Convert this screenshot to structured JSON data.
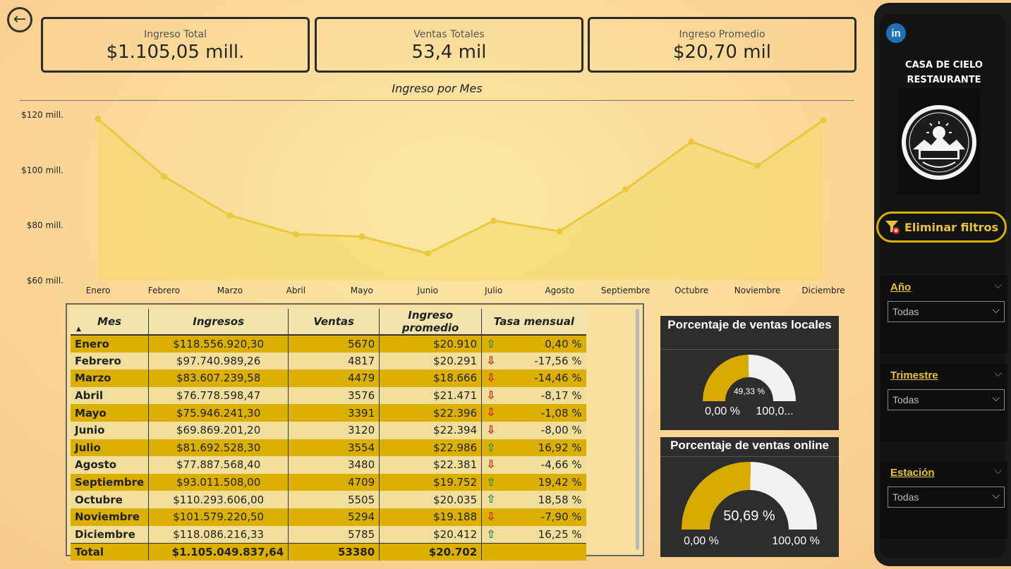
{
  "kpis": [
    {
      "label": "Ingreso Total",
      "value": "$1.105,05 mill."
    },
    {
      "label": "Ventas Totales",
      "value": "53,4 mil"
    },
    {
      "label": "Ingreso Promedio",
      "value": "$20,70 mil"
    }
  ],
  "chart_data": {
    "type": "area",
    "title": "Ingreso por Mes",
    "xlabel": "",
    "ylabel": "",
    "categories": [
      "Enero",
      "Febrero",
      "Marzo",
      "Abril",
      "Mayo",
      "Junio",
      "Julio",
      "Agosto",
      "Septiembre",
      "Octubre",
      "Noviembre",
      "Diciembre"
    ],
    "values": [
      118.56,
      97.74,
      83.61,
      76.78,
      75.95,
      69.87,
      81.69,
      77.89,
      93.01,
      110.29,
      101.58,
      118.09
    ],
    "yticks": [
      60,
      80,
      100,
      120
    ],
    "ytick_labels": [
      "$60 mill.",
      "$80 mill.",
      "$100 mill.",
      "$120 mill."
    ],
    "ylim": [
      60,
      120
    ],
    "unit": "mill.",
    "color": "#e9c93e",
    "fill_color": "#f3d868",
    "grid": false
  },
  "table": {
    "headers": [
      "Mes",
      "Ingresos",
      "Ventas",
      "Ingreso promedio",
      "Tasa mensual"
    ],
    "rows": [
      {
        "mes": "Enero",
        "ingresos": "$118.556.920,30",
        "ventas": "5670",
        "promedio": "$20.910",
        "tasa": "0,40 %",
        "trend": "up"
      },
      {
        "mes": "Febrero",
        "ingresos": "$97.740.989,26",
        "ventas": "4817",
        "promedio": "$20.291",
        "tasa": "-17,56 %",
        "trend": "down"
      },
      {
        "mes": "Marzo",
        "ingresos": "$83.607.239,58",
        "ventas": "4479",
        "promedio": "$18.666",
        "tasa": "-14,46 %",
        "trend": "down"
      },
      {
        "mes": "Abril",
        "ingresos": "$76.778.598,47",
        "ventas": "3576",
        "promedio": "$21.471",
        "tasa": "-8,17 %",
        "trend": "down"
      },
      {
        "mes": "Mayo",
        "ingresos": "$75.946.241,30",
        "ventas": "3391",
        "promedio": "$22.396",
        "tasa": "-1,08 %",
        "trend": "down"
      },
      {
        "mes": "Junio",
        "ingresos": "$69.869.201,20",
        "ventas": "3120",
        "promedio": "$22.394",
        "tasa": "-8,00 %",
        "trend": "down"
      },
      {
        "mes": "Julio",
        "ingresos": "$81.692.528,30",
        "ventas": "3554",
        "promedio": "$22.986",
        "tasa": "16,92 %",
        "trend": "up"
      },
      {
        "mes": "Agosto",
        "ingresos": "$77.887.568,40",
        "ventas": "3480",
        "promedio": "$22.381",
        "tasa": "-4,66 %",
        "trend": "down"
      },
      {
        "mes": "Septiembre",
        "ingresos": "$93.011.508,00",
        "ventas": "4709",
        "promedio": "$19.752",
        "tasa": "19,42 %",
        "trend": "up"
      },
      {
        "mes": "Octubre",
        "ingresos": "$110.293.606,00",
        "ventas": "5505",
        "promedio": "$20.035",
        "tasa": "18,58 %",
        "trend": "up"
      },
      {
        "mes": "Noviembre",
        "ingresos": "$101.579.220,50",
        "ventas": "5294",
        "promedio": "$19.188",
        "tasa": "-7,90 %",
        "trend": "down"
      },
      {
        "mes": "Diciembre",
        "ingresos": "$118.086.216,33",
        "ventas": "5785",
        "promedio": "$20.412",
        "tasa": "16,25 %",
        "trend": "up"
      }
    ],
    "total": {
      "mes": "Total",
      "ingresos": "$1.105.049.837,64",
      "ventas": "53380",
      "promedio": "$20.702"
    },
    "colors": {
      "up": "#2e8b57",
      "down": "#d11f1f"
    }
  },
  "gauges": {
    "local": {
      "title": "Porcentaje de ventas locales",
      "value": 49.33,
      "value_label": "49,33 %",
      "min_label": "0,00 %",
      "max_label": "100,0..."
    },
    "online": {
      "title": "Porcentaje de ventas online",
      "value": 50.69,
      "value_label": "50,69 %",
      "min_label": "0,00 %",
      "max_label": "100,00 %"
    },
    "fill_color": "#d7ab00",
    "rest_color": "#f2f2f2"
  },
  "sidebar": {
    "linkedin": "in",
    "brand_line1": "CASA DE CIELO",
    "brand_line2": "RESTAURANTE",
    "clear_filters": "Eliminar filtros",
    "filters": [
      {
        "label": "Año",
        "value": "Todas"
      },
      {
        "label": "Trimestre",
        "value": "Todas"
      },
      {
        "label": "Estación",
        "value": "Todas"
      }
    ]
  },
  "icons": {
    "back": "arrow-left-icon",
    "filter_clear": "filter-clear-icon",
    "trend_up": "arrow-up-icon",
    "trend_down": "arrow-down-icon",
    "chevron": "chevron-down-icon"
  }
}
